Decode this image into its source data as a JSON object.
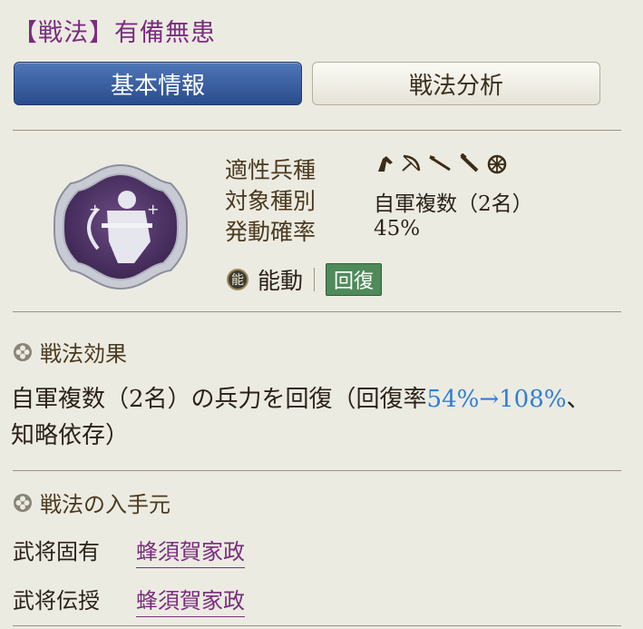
{
  "header": {
    "title": "【戦法】有備無患"
  },
  "tabs": [
    {
      "label": "基本情報",
      "active": true
    },
    {
      "label": "戦法分析",
      "active": false
    }
  ],
  "skill_info": {
    "troop_label": "適性兵種",
    "troop_icons": [
      "cavalry-icon",
      "bow-icon",
      "spear-icon",
      "gun-icon",
      "siege-icon"
    ],
    "target_label": "対象種別",
    "target_value": "自軍複数（2名）",
    "rate_label": "発動確率",
    "rate_value": "45%",
    "type_icon_char": "能",
    "type_label": "能動",
    "tag_label": "回復"
  },
  "effect": {
    "heading": "戦法効果",
    "text_before": "自軍複数（2名）の兵力を回復（回復率",
    "highlight_range": "54%→108%",
    "text_after": "、知略依存）"
  },
  "sources": {
    "heading": "戦法の入手元",
    "items": [
      {
        "label": "武将固有",
        "value": "蜂須賀家政"
      },
      {
        "label": "武将伝授",
        "value": "蜂須賀家政"
      }
    ]
  },
  "colors": {
    "accent_purple": "#7a2d7d",
    "tab_blue": "#2a4c8c",
    "highlight_blue": "#2f7fd6",
    "heal_green": "#4f8a5a"
  }
}
